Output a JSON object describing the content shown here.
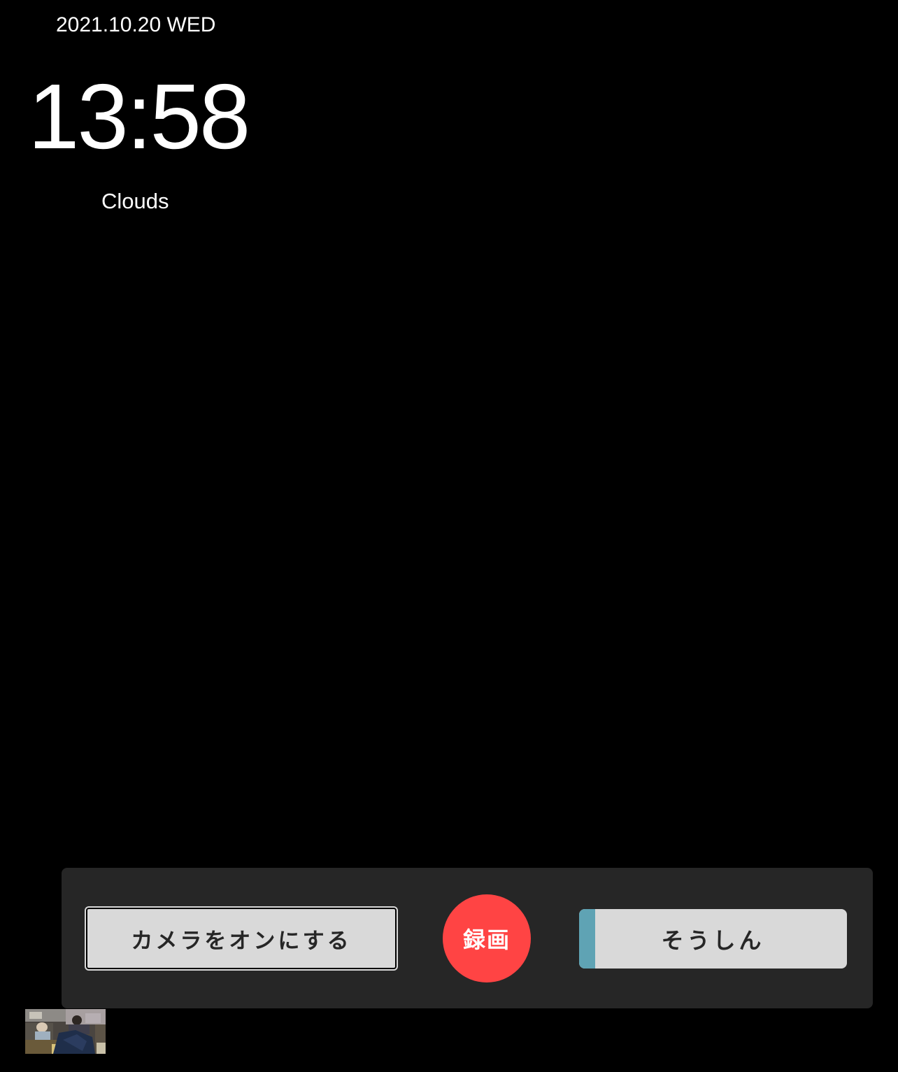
{
  "clock": {
    "date": "2021.10.20 WED",
    "time": "13:58",
    "weather": "Clouds"
  },
  "controls": {
    "camera_label": "カメラをオンにする",
    "record_label": "録画",
    "send_label": "そうしん",
    "send_progress": 0.06
  },
  "preview": {
    "description_icon": "camera-preview-thumbnail"
  },
  "colors": {
    "background": "#000000",
    "panel": "#262626",
    "button": "#d9d9d9",
    "record": "#ff4444",
    "progress": "#5fa3b4"
  }
}
